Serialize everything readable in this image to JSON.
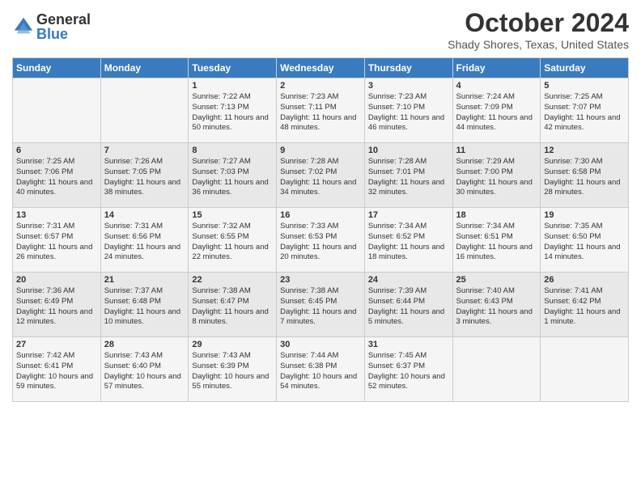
{
  "header": {
    "logo_general": "General",
    "logo_blue": "Blue",
    "title": "October 2024",
    "location": "Shady Shores, Texas, United States"
  },
  "days_of_week": [
    "Sunday",
    "Monday",
    "Tuesday",
    "Wednesday",
    "Thursday",
    "Friday",
    "Saturday"
  ],
  "weeks": [
    [
      {
        "day": "",
        "info": ""
      },
      {
        "day": "",
        "info": ""
      },
      {
        "day": "1",
        "info": "Sunrise: 7:22 AM\nSunset: 7:13 PM\nDaylight: 11 hours and 50 minutes."
      },
      {
        "day": "2",
        "info": "Sunrise: 7:23 AM\nSunset: 7:11 PM\nDaylight: 11 hours and 48 minutes."
      },
      {
        "day": "3",
        "info": "Sunrise: 7:23 AM\nSunset: 7:10 PM\nDaylight: 11 hours and 46 minutes."
      },
      {
        "day": "4",
        "info": "Sunrise: 7:24 AM\nSunset: 7:09 PM\nDaylight: 11 hours and 44 minutes."
      },
      {
        "day": "5",
        "info": "Sunrise: 7:25 AM\nSunset: 7:07 PM\nDaylight: 11 hours and 42 minutes."
      }
    ],
    [
      {
        "day": "6",
        "info": "Sunrise: 7:25 AM\nSunset: 7:06 PM\nDaylight: 11 hours and 40 minutes."
      },
      {
        "day": "7",
        "info": "Sunrise: 7:26 AM\nSunset: 7:05 PM\nDaylight: 11 hours and 38 minutes."
      },
      {
        "day": "8",
        "info": "Sunrise: 7:27 AM\nSunset: 7:03 PM\nDaylight: 11 hours and 36 minutes."
      },
      {
        "day": "9",
        "info": "Sunrise: 7:28 AM\nSunset: 7:02 PM\nDaylight: 11 hours and 34 minutes."
      },
      {
        "day": "10",
        "info": "Sunrise: 7:28 AM\nSunset: 7:01 PM\nDaylight: 11 hours and 32 minutes."
      },
      {
        "day": "11",
        "info": "Sunrise: 7:29 AM\nSunset: 7:00 PM\nDaylight: 11 hours and 30 minutes."
      },
      {
        "day": "12",
        "info": "Sunrise: 7:30 AM\nSunset: 6:58 PM\nDaylight: 11 hours and 28 minutes."
      }
    ],
    [
      {
        "day": "13",
        "info": "Sunrise: 7:31 AM\nSunset: 6:57 PM\nDaylight: 11 hours and 26 minutes."
      },
      {
        "day": "14",
        "info": "Sunrise: 7:31 AM\nSunset: 6:56 PM\nDaylight: 11 hours and 24 minutes."
      },
      {
        "day": "15",
        "info": "Sunrise: 7:32 AM\nSunset: 6:55 PM\nDaylight: 11 hours and 22 minutes."
      },
      {
        "day": "16",
        "info": "Sunrise: 7:33 AM\nSunset: 6:53 PM\nDaylight: 11 hours and 20 minutes."
      },
      {
        "day": "17",
        "info": "Sunrise: 7:34 AM\nSunset: 6:52 PM\nDaylight: 11 hours and 18 minutes."
      },
      {
        "day": "18",
        "info": "Sunrise: 7:34 AM\nSunset: 6:51 PM\nDaylight: 11 hours and 16 minutes."
      },
      {
        "day": "19",
        "info": "Sunrise: 7:35 AM\nSunset: 6:50 PM\nDaylight: 11 hours and 14 minutes."
      }
    ],
    [
      {
        "day": "20",
        "info": "Sunrise: 7:36 AM\nSunset: 6:49 PM\nDaylight: 11 hours and 12 minutes."
      },
      {
        "day": "21",
        "info": "Sunrise: 7:37 AM\nSunset: 6:48 PM\nDaylight: 11 hours and 10 minutes."
      },
      {
        "day": "22",
        "info": "Sunrise: 7:38 AM\nSunset: 6:47 PM\nDaylight: 11 hours and 8 minutes."
      },
      {
        "day": "23",
        "info": "Sunrise: 7:38 AM\nSunset: 6:45 PM\nDaylight: 11 hours and 7 minutes."
      },
      {
        "day": "24",
        "info": "Sunrise: 7:39 AM\nSunset: 6:44 PM\nDaylight: 11 hours and 5 minutes."
      },
      {
        "day": "25",
        "info": "Sunrise: 7:40 AM\nSunset: 6:43 PM\nDaylight: 11 hours and 3 minutes."
      },
      {
        "day": "26",
        "info": "Sunrise: 7:41 AM\nSunset: 6:42 PM\nDaylight: 11 hours and 1 minute."
      }
    ],
    [
      {
        "day": "27",
        "info": "Sunrise: 7:42 AM\nSunset: 6:41 PM\nDaylight: 10 hours and 59 minutes."
      },
      {
        "day": "28",
        "info": "Sunrise: 7:43 AM\nSunset: 6:40 PM\nDaylight: 10 hours and 57 minutes."
      },
      {
        "day": "29",
        "info": "Sunrise: 7:43 AM\nSunset: 6:39 PM\nDaylight: 10 hours and 55 minutes."
      },
      {
        "day": "30",
        "info": "Sunrise: 7:44 AM\nSunset: 6:38 PM\nDaylight: 10 hours and 54 minutes."
      },
      {
        "day": "31",
        "info": "Sunrise: 7:45 AM\nSunset: 6:37 PM\nDaylight: 10 hours and 52 minutes."
      },
      {
        "day": "",
        "info": ""
      },
      {
        "day": "",
        "info": ""
      }
    ]
  ]
}
